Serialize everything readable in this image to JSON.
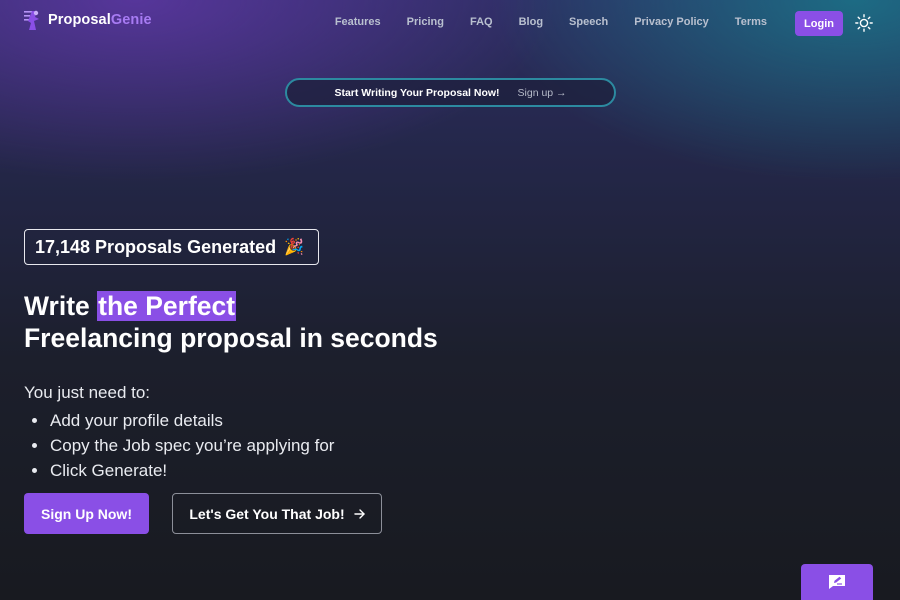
{
  "brand": {
    "name_part1": "Proposal",
    "name_part2": "Genie",
    "logo_icon": "genie-icon",
    "accent_color": "#8a4fe6"
  },
  "nav": {
    "links": [
      "Features",
      "Pricing",
      "FAQ",
      "Blog",
      "Speech",
      "Privacy Policy",
      "Terms"
    ],
    "login_label": "Login",
    "theme_icon": "sun-icon"
  },
  "banner": {
    "text": "Start Writing Your Proposal Now!",
    "link": "Sign up →"
  },
  "hero": {
    "counter": "17,148 Proposals Generated",
    "counter_emoji": "🎉",
    "headline_pre": "Write ",
    "headline_highlight": "the Perfect",
    "headline_line2": "Freelancing proposal in seconds",
    "intro": "You just need to:",
    "steps": [
      "Add your profile details",
      "Copy the Job spec you’re applying for",
      "Click Generate!"
    ],
    "primary_cta": "Sign Up Now!",
    "secondary_cta": "Let's Get You That Job!",
    "secondary_cta_icon": "arrow-right-icon"
  },
  "feedback": {
    "icon": "feedback-icon"
  }
}
